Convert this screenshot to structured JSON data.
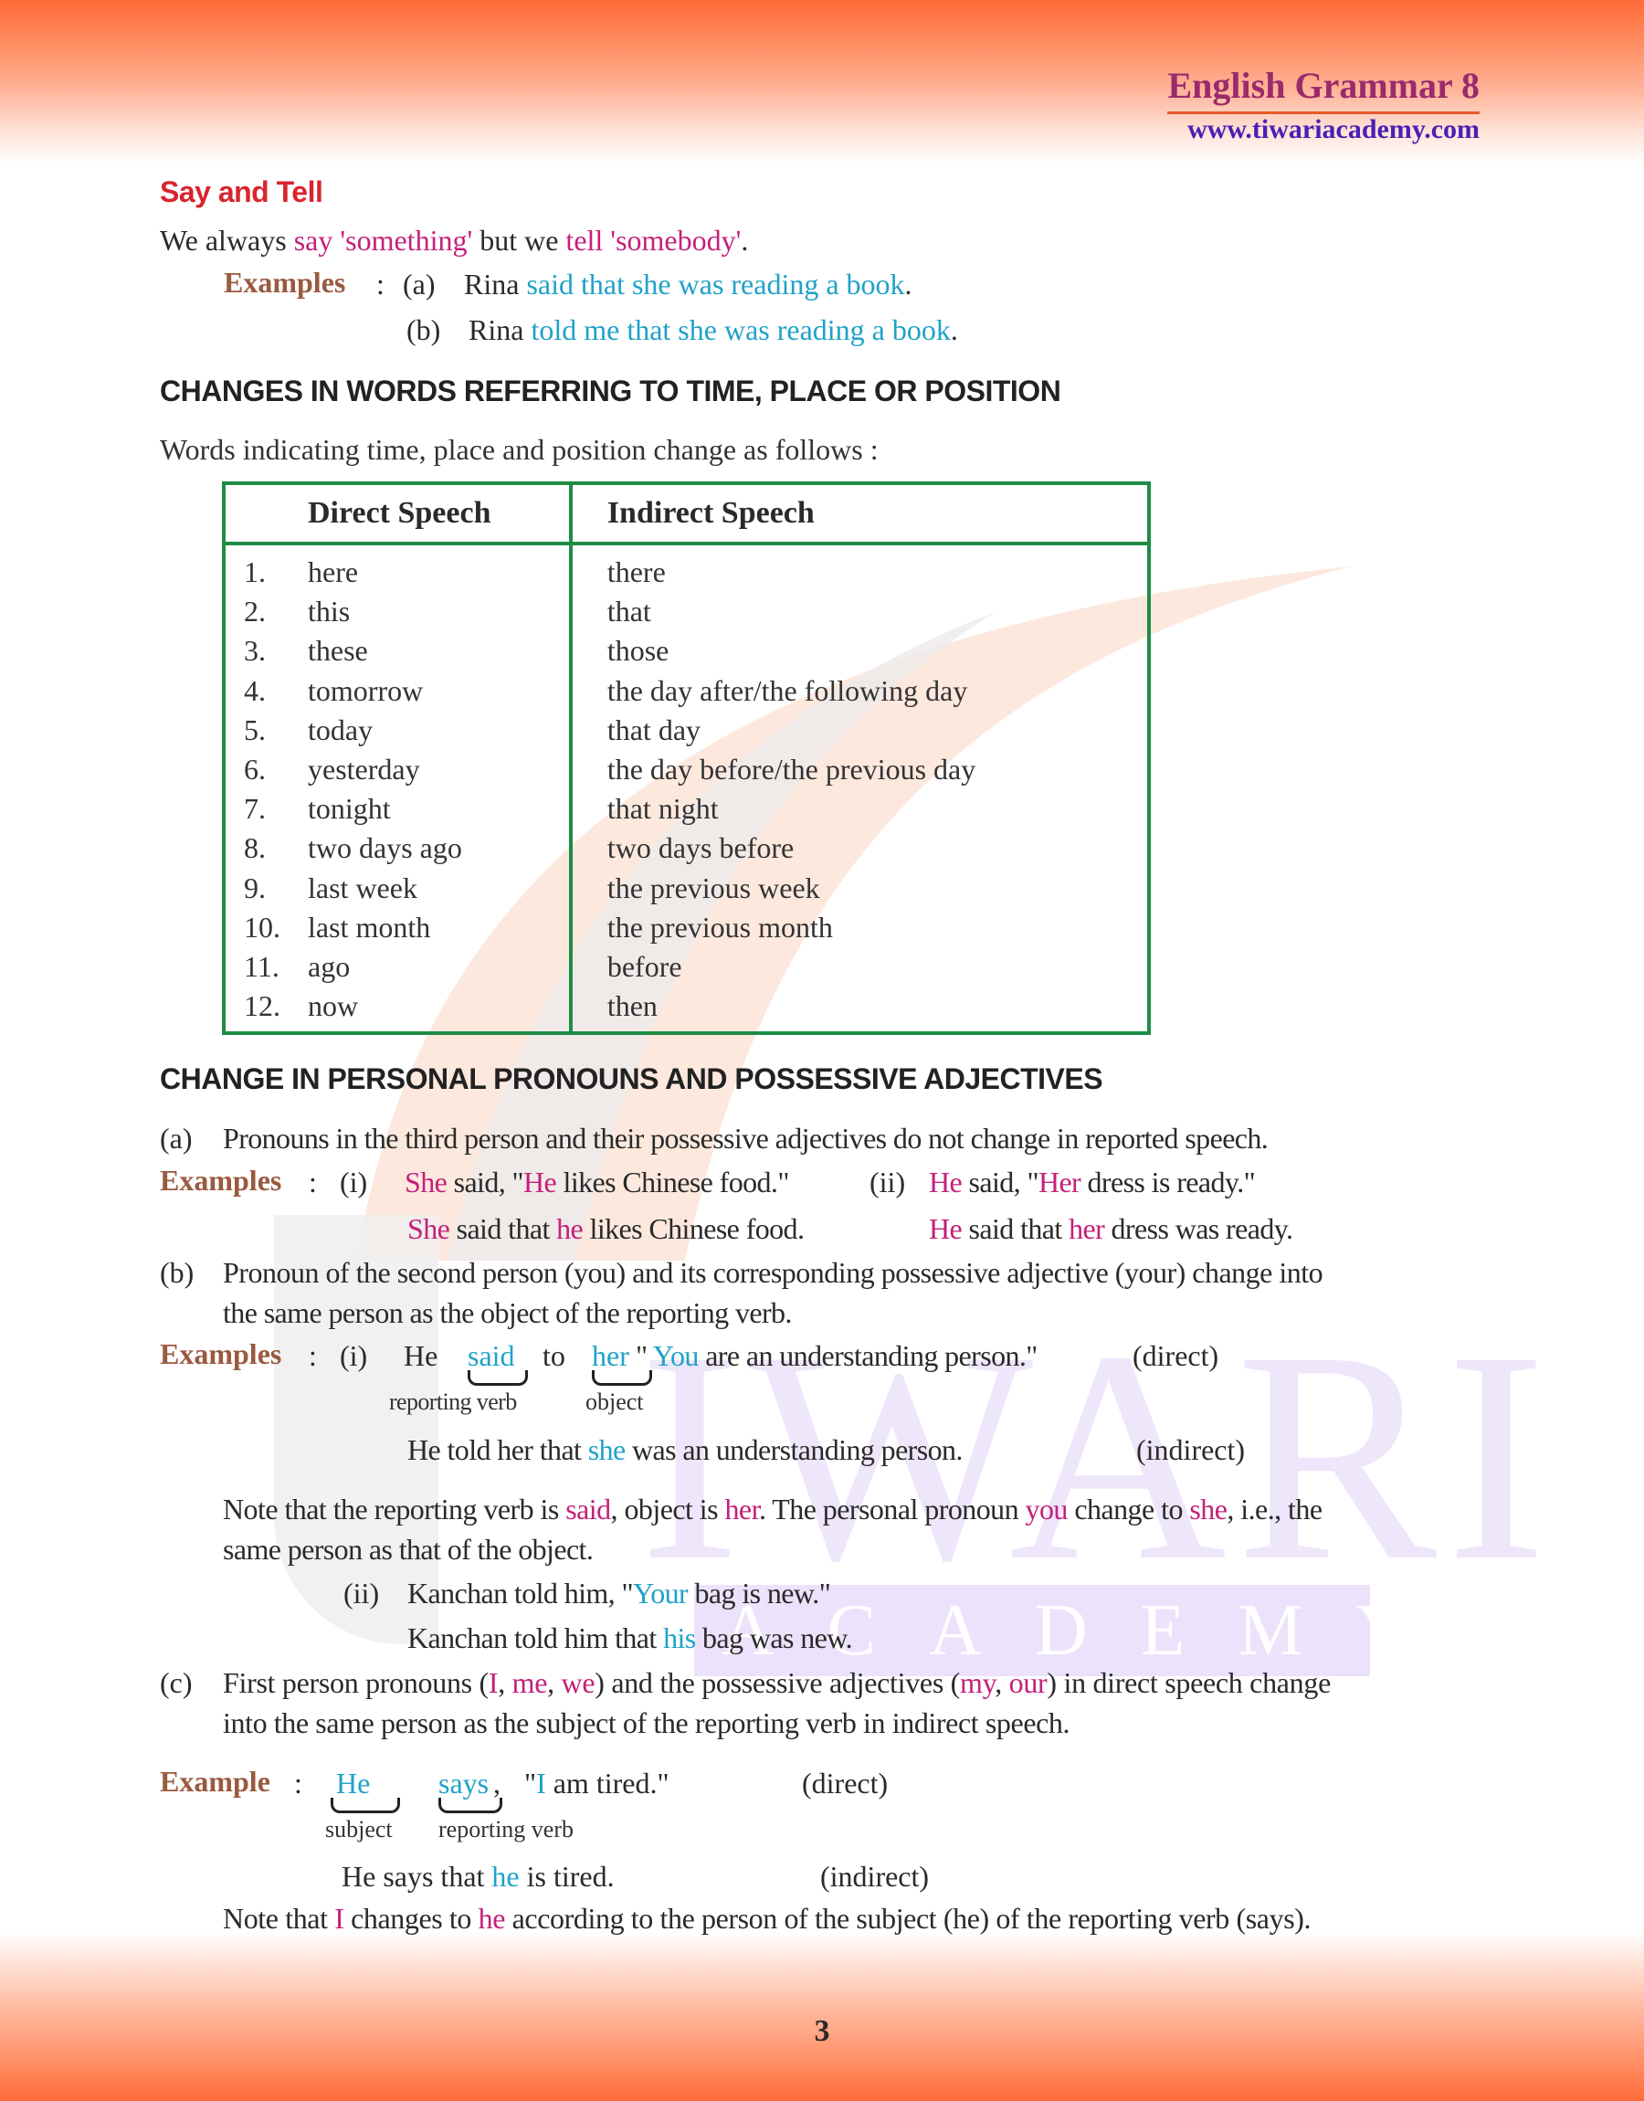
{
  "header": {
    "title": "English Grammar 8",
    "website": "www.tiwariacademy.com"
  },
  "watermark": {
    "word1": "IWARI",
    "word2": "ACADEMY"
  },
  "say_tell": {
    "heading": "Say and Tell",
    "rule": {
      "p1": "We always ",
      "say": "say 'something'",
      "p2": " but we ",
      "tell": "tell 'somebody'",
      "p3": "."
    },
    "examples_label": "Examples",
    "colon": ":",
    "ex_a": {
      "marker": "(a)",
      "subject": "Rina",
      "rest": "said that she was reading a book",
      "end": "."
    },
    "ex_b": {
      "marker": "(b)",
      "subject": "Rina",
      "rest": "told me that she was reading a book",
      "end": "."
    }
  },
  "time_place": {
    "heading": "CHANGES IN WORDS REFERRING TO TIME, PLACE OR POSITION",
    "intro": "Words indicating time, place and position change as follows :",
    "table": {
      "col1": "Direct Speech",
      "col2": "Indirect Speech",
      "rows": [
        {
          "n": "1.",
          "direct": "here",
          "indirect": "there"
        },
        {
          "n": "2.",
          "direct": "this",
          "indirect": "that"
        },
        {
          "n": "3.",
          "direct": "these",
          "indirect": "those"
        },
        {
          "n": "4.",
          "direct": "tomorrow",
          "indirect": "the day after/the following day"
        },
        {
          "n": "5.",
          "direct": "today",
          "indirect": "that day"
        },
        {
          "n": "6.",
          "direct": "yesterday",
          "indirect": "the day before/the previous day"
        },
        {
          "n": "7.",
          "direct": "tonight",
          "indirect": "that night"
        },
        {
          "n": "8.",
          "direct": "two days ago",
          "indirect": "two days before"
        },
        {
          "n": "9.",
          "direct": "last week",
          "indirect": "the previous week"
        },
        {
          "n": "10.",
          "direct": "last month",
          "indirect": "the previous month"
        },
        {
          "n": "11.",
          "direct": "ago",
          "indirect": "before"
        },
        {
          "n": "12.",
          "direct": "now",
          "indirect": "then"
        }
      ]
    }
  },
  "pronouns": {
    "heading": "CHANGE IN PERSONAL PRONOUNS AND POSSESSIVE ADJECTIVES",
    "a": {
      "marker": "(a)",
      "text": "Pronouns in the third person and their possessive adjectives do not change in reported speech.",
      "examples_label": "Examples",
      "colon": ":",
      "i_marker": "(i)",
      "i_direct": {
        "s1": "She",
        "s2": " said, \"",
        "s3": "He",
        "s4": " likes Chinese food.\""
      },
      "i_indirect": {
        "s1": "She",
        "s2": " said that ",
        "s3": "he",
        "s4": " likes Chinese food."
      },
      "ii_marker": "(ii)",
      "ii_direct": {
        "s1": "He",
        "s2": " said, \"",
        "s3": "Her",
        "s4": " dress is ready.\""
      },
      "ii_indirect": {
        "s1": "He",
        "s2": " said that ",
        "s3": "her",
        "s4": " dress was ready."
      }
    },
    "b": {
      "marker": "(b)",
      "line1": "Pronoun of the second person (you) and its corresponding possessive adjective (your) change into",
      "line2": "the same person as the object of the reporting verb.",
      "examples_label": "Examples",
      "colon": ":",
      "i_marker": "(i)",
      "direct": {
        "w1": "He",
        "w2": "said",
        "w3": "to",
        "w4": "her",
        "w5": "\"",
        "w6": "You",
        "w7": " are an understanding person.\""
      },
      "direct_tag": "(direct)",
      "brace_label_verb": "reporting verb",
      "brace_label_object": "object",
      "indirect": {
        "s1": "He told her that ",
        "s2": "she",
        "s3": " was an understanding person."
      },
      "indirect_tag": "(indirect)",
      "note": {
        "n1": "Note that the reporting verb is ",
        "n2": "said",
        "n3": ", object is ",
        "n4": "her",
        "n5": ". The personal pronoun ",
        "n6": "you",
        "n7": " change to ",
        "n8": "she",
        "n9": ", i.e., the",
        "line2": "same person as that of the object."
      },
      "ii_marker": "(ii)",
      "ii_direct": {
        "s1": "Kanchan told him, \"",
        "s2": "Your",
        "s3": " bag is new.\""
      },
      "ii_indirect": {
        "s1": "Kanchan told him that ",
        "s2": "his",
        "s3": " bag was new."
      }
    },
    "c": {
      "marker": "(c)",
      "l1a": "First person pronouns (",
      "l1b": "I",
      "l1c": ", ",
      "l1d": "me",
      "l1e": ", ",
      "l1f": "we",
      "l1g": ") and the possessive adjectives (",
      "l1h": "my",
      "l1i": ", ",
      "l1j": "our",
      "l1k": ") in direct speech change",
      "line2": "into the same person as the subject of the reporting verb in indirect speech.",
      "example_label": "Example",
      "colon": ":",
      "direct": {
        "w1": "He",
        "w2": "says",
        "w3": ",",
        "w4": "\"",
        "w5": "I",
        "w6": " am tired.\""
      },
      "direct_tag": "(direct)",
      "brace_label_subject": "subject",
      "brace_label_verb": "reporting verb",
      "indirect": {
        "s1": "He says that ",
        "s2": "he",
        "s3": " is tired."
      },
      "indirect_tag": "(indirect)",
      "note": {
        "n1": "Note that ",
        "n2": "I",
        "n3": " changes to ",
        "n4": "he",
        "n5": " according to the person of the subject (he) of the reporting verb (says)."
      }
    }
  },
  "footer": {
    "page_number": "3"
  }
}
